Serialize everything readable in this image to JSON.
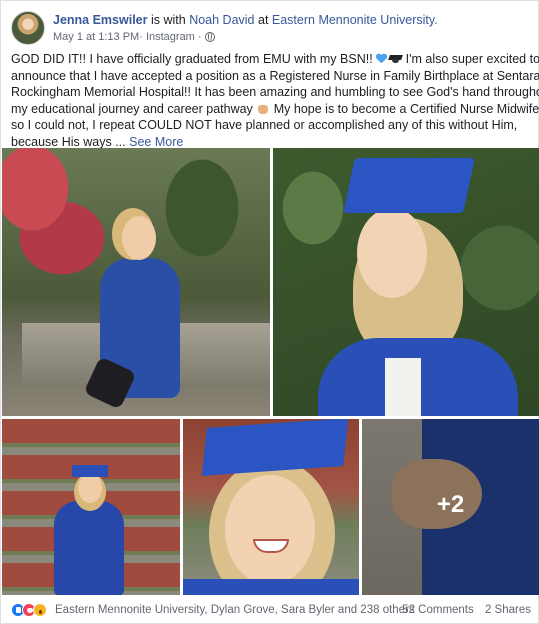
{
  "post": {
    "author": "Jenna Emswiler",
    "with_text": " is with ",
    "tagged": "Noah David",
    "at_text": " at ",
    "location": "Eastern Mennonite University.",
    "timestamp": "May 1 at 1:13 PM",
    "source": " · Instagram · ",
    "privacy_icon": "globe-icon"
  },
  "body": {
    "line1a": "GOD DID IT!! I have officially graduated from EMU with my BSN!! ",
    "line1b": " I'm also super excited to",
    "line2": "announce that I have accepted a position as a Registered Nurse in Family Birthplace at Sentara",
    "line3": "Rockingham Memorial Hospital!! It has been amazing and humbling to see God's hand throughout",
    "line4a": "my educational journey and career pathway ",
    "line4b": " My hope is to become a Certified Nurse Midwife,",
    "line5": "so I could not, I repeat COULD NOT have planned or accomplished any of this without Him,",
    "line6": "because His ways ... ",
    "see_more": "See More"
  },
  "photos": {
    "more_count": "+2"
  },
  "footer": {
    "reactions": [
      "like-icon",
      "love-icon",
      "wow-icon"
    ],
    "reactors": "Eastern Mennonite University, Dylan Grove, Sara Byler and 238 others",
    "comments": "52 Comments",
    "shares": "2 Shares"
  },
  "colors": {
    "link": "#385898",
    "text": "#1c1e21",
    "meta": "#616770",
    "like": "#1877f2",
    "love": "#f33e58",
    "wow": "#f7b125"
  }
}
